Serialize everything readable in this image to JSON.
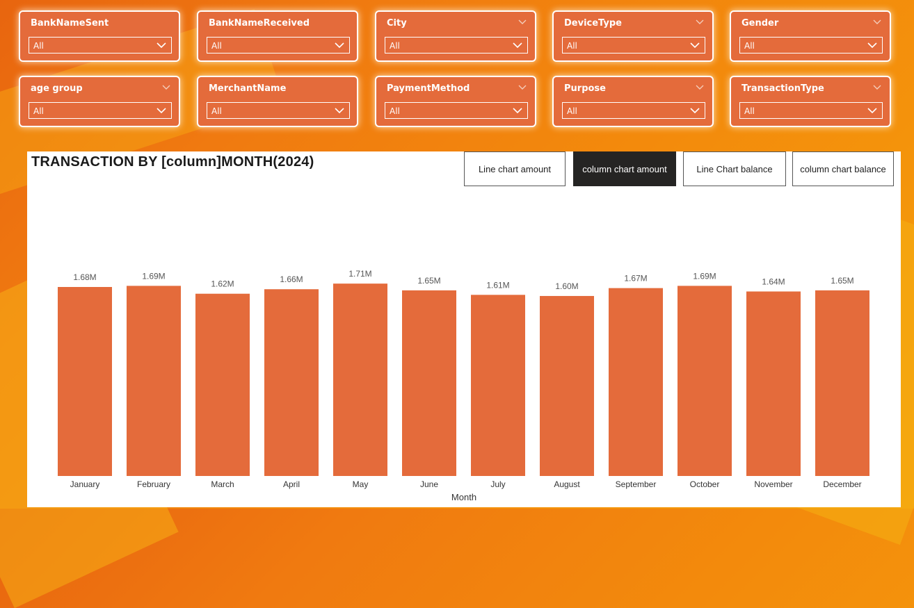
{
  "slicers": [
    {
      "title": "BankNameSent",
      "value": "All",
      "corner": false
    },
    {
      "title": "BankNameReceived",
      "value": "All",
      "corner": false
    },
    {
      "title": "City",
      "value": "All",
      "corner": true
    },
    {
      "title": "DeviceType",
      "value": "All",
      "corner": true
    },
    {
      "title": "Gender",
      "value": "All",
      "corner": true
    },
    {
      "title": "age group",
      "value": "All",
      "corner": true
    },
    {
      "title": "MerchantName",
      "value": "All",
      "corner": false
    },
    {
      "title": "PaymentMethod",
      "value": "All",
      "corner": true
    },
    {
      "title": "Purpose",
      "value": "All",
      "corner": true
    },
    {
      "title": "TransactionType",
      "value": "All",
      "corner": true
    }
  ],
  "chart_title": "TRANSACTION BY [column]MONTH(2024)",
  "toggles": [
    {
      "label": "Line chart amount",
      "active": false
    },
    {
      "label": "column chart amount",
      "active": true
    },
    {
      "label": "Line Chart balance",
      "active": false
    },
    {
      "label": "column chart balance",
      "active": false
    }
  ],
  "colors": {
    "bar": "#e46b3b",
    "slicer_bg": "#e46b3b"
  },
  "chart_data": {
    "type": "bar",
    "title": "TRANSACTION BY [column]MONTH(2024)",
    "xlabel": "Month",
    "ylabel": "",
    "categories": [
      "January",
      "February",
      "March",
      "April",
      "May",
      "June",
      "July",
      "August",
      "September",
      "October",
      "November",
      "December"
    ],
    "values": [
      1.68,
      1.69,
      1.62,
      1.66,
      1.71,
      1.65,
      1.61,
      1.6,
      1.67,
      1.69,
      1.64,
      1.65
    ],
    "value_labels": [
      "1.68M",
      "1.69M",
      "1.62M",
      "1.66M",
      "1.71M",
      "1.65M",
      "1.61M",
      "1.60M",
      "1.67M",
      "1.69M",
      "1.64M",
      "1.65M"
    ],
    "unit": "M"
  }
}
